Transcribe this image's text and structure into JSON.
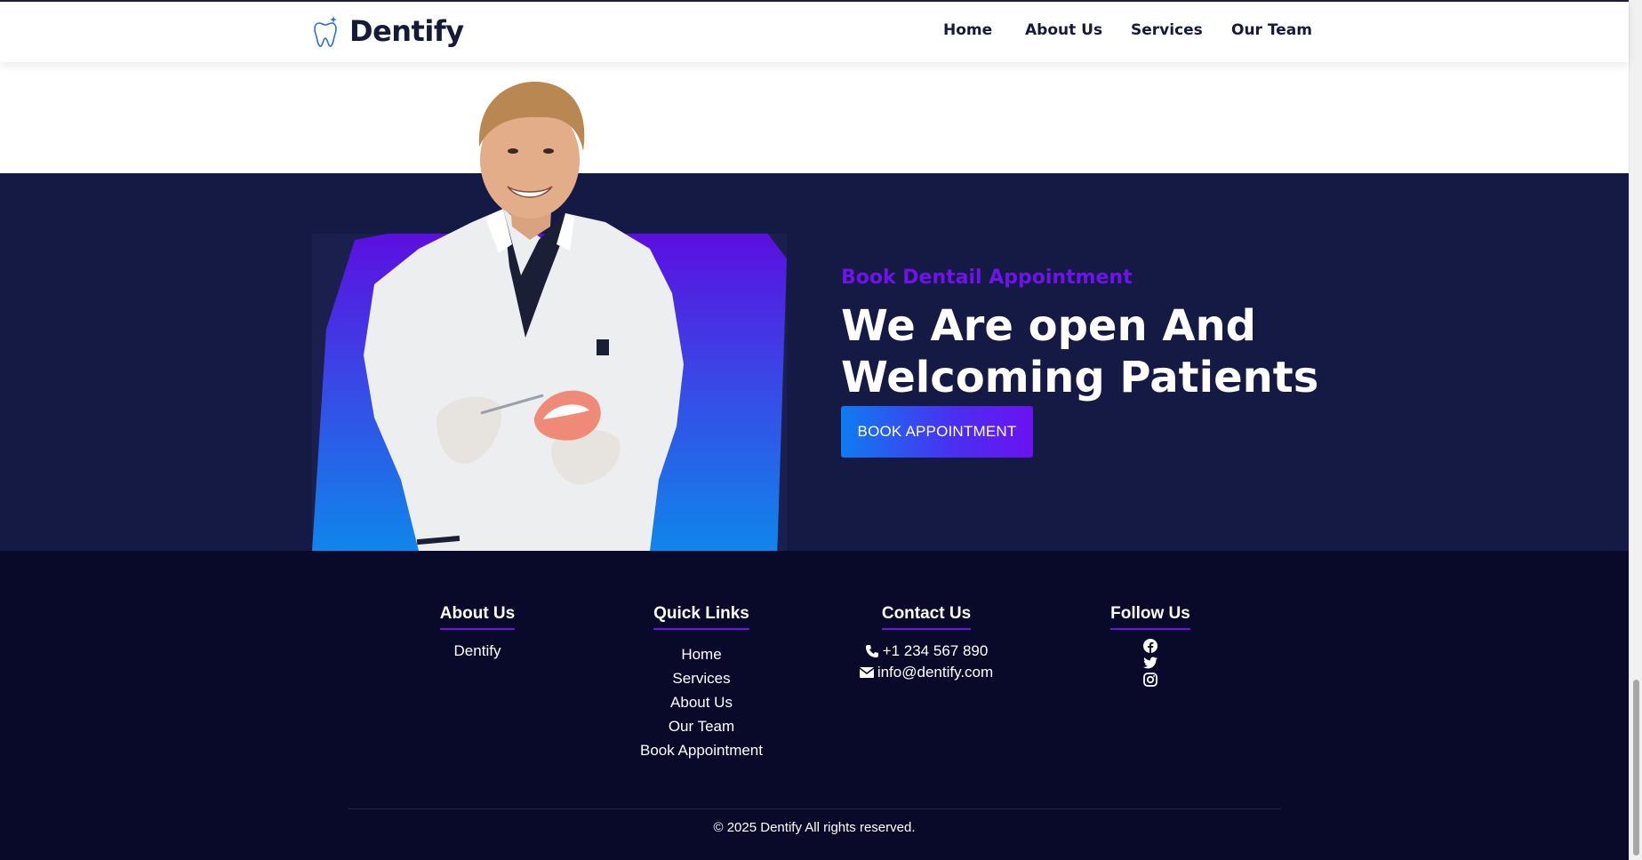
{
  "header": {
    "brand": "Dentify",
    "nav": [
      {
        "label": "Home"
      },
      {
        "label": "About Us"
      },
      {
        "label": "Services"
      },
      {
        "label": "Our Team"
      }
    ]
  },
  "hero": {
    "kicker": "Book Dentail Appointment",
    "title": "We Are open And Welcoming Patients",
    "button": "BOOK APPOINTMENT"
  },
  "footer": {
    "about": {
      "title": "About Us",
      "text": "Dentify"
    },
    "quick_links": {
      "title": "Quick Links",
      "links": [
        {
          "label": "Home"
        },
        {
          "label": "Services"
        },
        {
          "label": "About Us"
        },
        {
          "label": "Our Team"
        },
        {
          "label": "Book Appointment"
        }
      ]
    },
    "contact": {
      "title": "Contact Us",
      "phone": "+1 234 567 890",
      "email": "info@dentify.com"
    },
    "follow": {
      "title": "Follow Us",
      "icons": [
        "facebook-icon",
        "twitter-icon",
        "instagram-icon"
      ]
    },
    "copyright": "© 2025 Dentify All rights reserved."
  },
  "colors": {
    "navy": "#141a44",
    "footer": "#090a2a",
    "accent": "#6d14e8",
    "button_start": "#0f7cf0",
    "button_end": "#6b12f2"
  }
}
